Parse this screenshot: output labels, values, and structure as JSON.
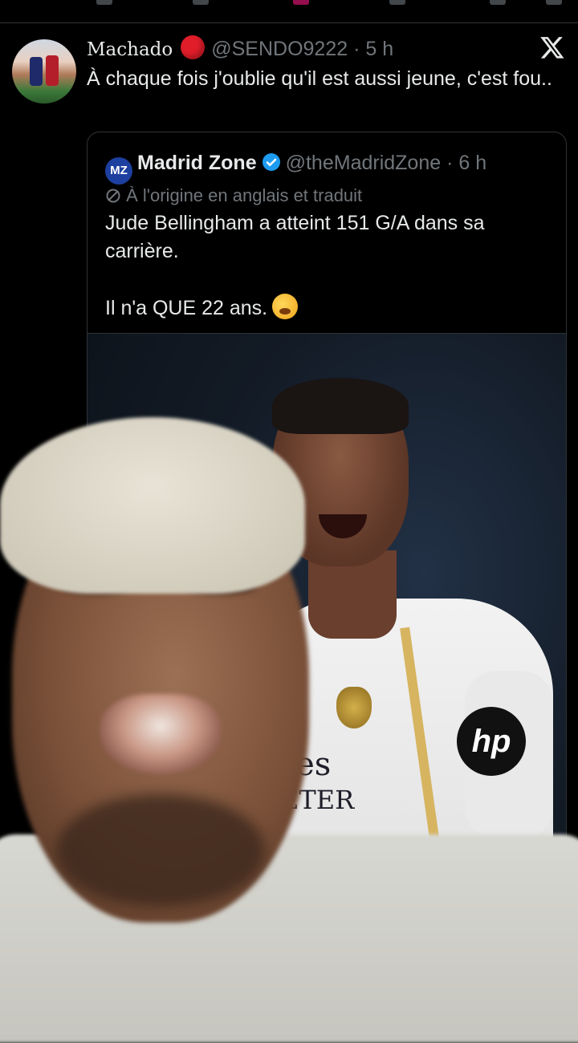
{
  "tweet": {
    "display_name": "Machado",
    "handle": "@SENDO9222",
    "separator": "·",
    "time": "5 h",
    "text": "À chaque fois j'oublie qu'il est aussi jeune, c'est fou..",
    "avatar_icon": "profile-avatar",
    "logo_icon": "x-logo-icon"
  },
  "quote": {
    "badge_text": "MZ",
    "display_name": "Madrid Zone",
    "handle": "@theMadridZone",
    "separator": "·",
    "time": "6 h",
    "translation_note": "À l'origine en anglais et traduit",
    "line1": "Jude Bellingham a atteint 151 G/A dans sa carrière.",
    "line2": "Il n'a QUE 22 ans.",
    "emoji_icon": "exploding-head-emoji-icon",
    "verified_color": "#1d9bf0",
    "photo": {
      "sponsor_text_1": "res",
      "sponsor_text_2": "ETER",
      "kit_logo": "hp"
    }
  },
  "colors": {
    "background": "#000000",
    "text": "#e7e9ea",
    "muted": "#71767b",
    "border": "#2f3336",
    "live_dot": "#e11d2a"
  }
}
